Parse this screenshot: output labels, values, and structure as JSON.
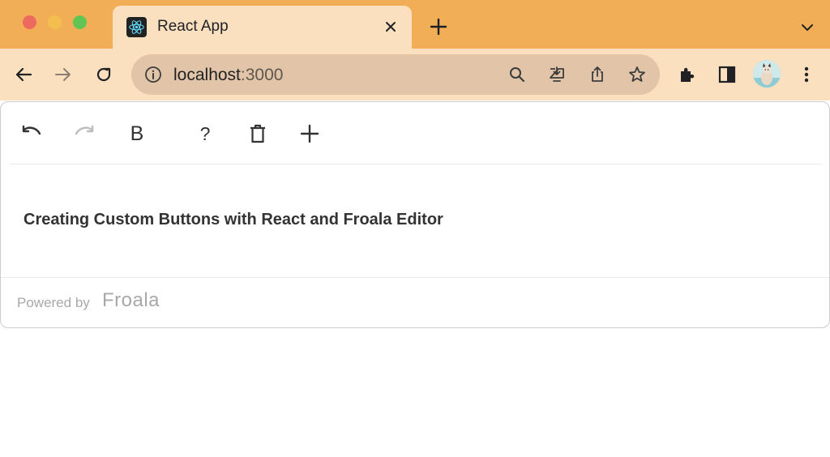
{
  "browser": {
    "tab": {
      "title": "React App",
      "favicon": "react-logo-icon"
    },
    "address_bar": {
      "host": "localhost",
      "port_path": ":3000"
    },
    "icons": [
      "back-arrow-icon",
      "forward-arrow-icon",
      "reload-icon",
      "info-icon",
      "search-icon",
      "install-app-icon",
      "share-icon",
      "bookmark-star-icon",
      "extensions-icon",
      "side-panel-icon",
      "profile-avatar",
      "more-vertical-icon"
    ]
  },
  "editor": {
    "toolbar": {
      "undo": "undo-icon",
      "redo": "redo-icon",
      "bold_label": "B",
      "help_label": "?",
      "delete": "trash-icon",
      "insert": "plus-icon"
    },
    "content_text": "Creating Custom Buttons with React and Froala Editor",
    "footer": {
      "powered_by": "Powered by",
      "brand": "Froala"
    }
  },
  "colors": {
    "tabstrip": "#f1ae56",
    "toolbar": "#fbe0c0",
    "omnibox": "#e2c5a8",
    "editor_text": "#333333"
  }
}
